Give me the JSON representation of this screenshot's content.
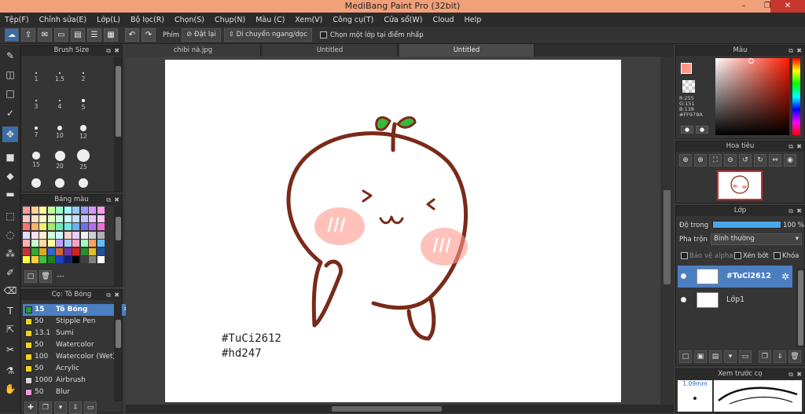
{
  "app": {
    "title": "MediBang Paint Pro (32bit)",
    "min_label": "–",
    "max_label": "❐",
    "close_label": "✕"
  },
  "menu": [
    "Tệp(F)",
    "Chỉnh sửa(E)",
    "Lớp(L)",
    "Bộ lọc(R)",
    "Chọn(S)",
    "Chụp(N)",
    "Màu (C)",
    "Xem(V)",
    "Công cụ(T)",
    "Cửa sổ(W)",
    "Cloud",
    "Help"
  ],
  "toolbar": {
    "phim_label": "Phím",
    "reset_label": "Đặt lại",
    "move_label": "Di chuyển ngang/dọc",
    "select_layer_label": "Chọn một lớp tại điểm nhấp"
  },
  "brush_size_panel": {
    "title": "Brush Size",
    "sizes": [
      "1",
      "1.5",
      "2",
      "3",
      "4",
      "5",
      "7",
      "10",
      "12",
      "15",
      "20",
      "25",
      "",
      "",
      ""
    ]
  },
  "palette_panel": {
    "title": "Bảng màu",
    "footer": "---"
  },
  "brush_panel": {
    "title": "Cọ: Tô Bóng",
    "items": [
      {
        "size": "15",
        "name": "Tô Bóng",
        "color": "#2a9d2a",
        "selected": true
      },
      {
        "size": "50",
        "name": "Stipple Pen",
        "color": "#f2d21a"
      },
      {
        "size": "13.1",
        "name": "Sumi",
        "color": "#f2d21a"
      },
      {
        "size": "50",
        "name": "Watercolor",
        "color": "#f2d21a"
      },
      {
        "size": "100",
        "name": "Watercolor (Wet)",
        "color": "#f2d21a"
      },
      {
        "size": "50",
        "name": "Acrylic",
        "color": "#f2d21a"
      },
      {
        "size": "1000",
        "name": "Airbrush",
        "color": "#d8d8d8"
      },
      {
        "size": "50",
        "name": "Blur",
        "color": "#f29ad8"
      }
    ]
  },
  "doc_tabs": [
    "chibi nà.jpg",
    "Untitled",
    "Untitled"
  ],
  "canvas": {
    "tag1": "#TuCi2612",
    "tag2": "#hd247"
  },
  "color_panel": {
    "title": "Màu",
    "r": "R:255",
    "g": "G:151",
    "b": "B:138",
    "hex": "#FF978A"
  },
  "navigator_panel": {
    "title": "Hoa tiêu"
  },
  "layer_panel": {
    "title": "Lớp",
    "opacity_label": "Độ trong",
    "opacity_value": "100 %",
    "blend_label": "Pha trộn",
    "blend_value": "Bình thường",
    "protect_alpha": "Bảo vệ alpha",
    "clip": "Xén bớt",
    "lock": "Khóa",
    "layers": [
      {
        "name": "#TuCi2612",
        "selected": true
      },
      {
        "name": "Lớp1",
        "selected": false
      }
    ]
  },
  "preview_panel": {
    "title": "Xem trước cọ",
    "size_label": "1.09mm"
  },
  "colors": {
    "accent": "#4b7fc1",
    "title_bar": "#f2a07a",
    "current_color": "#ff978a"
  }
}
